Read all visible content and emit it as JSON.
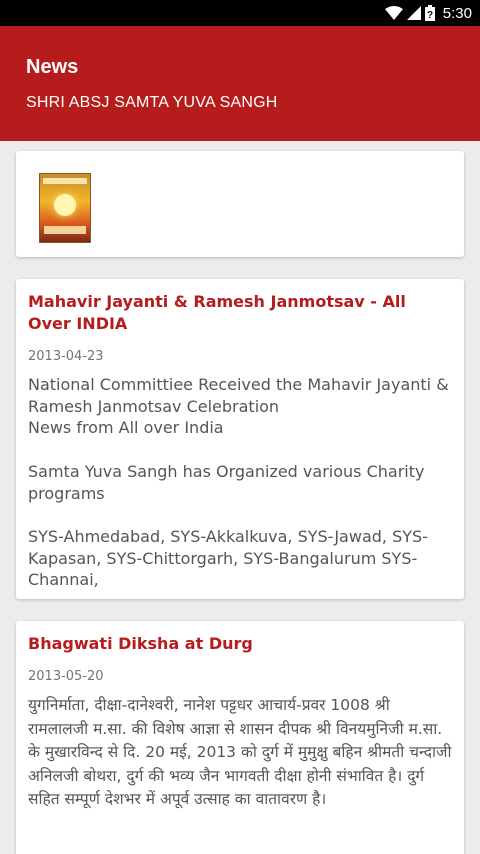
{
  "status_bar": {
    "time": "5:30",
    "icons": [
      "wifi-icon",
      "signal-icon",
      "battery-icon"
    ]
  },
  "app_bar": {
    "title": "News",
    "subtitle": "SHRI ABSJ SAMTA YUVA SANGH",
    "color": "#b71c1c"
  },
  "news": [
    {
      "title": "Mahavir Jayanti & Ramesh Janmotsav - All Over INDIA",
      "date": "2013-04-23",
      "body": "National Committiee Received the Mahavir Jayanti & Ramesh Janmotsav Celebration\nNews from All over India\n\nSamta Yuva Sangh has Organized various Charity programs\n\nSYS-Ahmedabad, SYS-Akkalkuva, SYS-Jawad, SYS-Kapasan, SYS-Chittorgarh, SYS-Bangalurum SYS-Channai,"
    },
    {
      "title": "Bhagwati Diksha at Durg",
      "date": "2013-05-20",
      "body": "युगनिर्माता, दीक्षा-दानेश्वरी, नानेश पट्टधर आचार्य-प्रवर 1008 श्री रामलालजी म.सा. की विशेष आज्ञा से शासन दीपक श्री विनयमुनिजी म.सा. के मुखारविन्द से दि. 20 मई, 2013 को दुर्ग में मुमुक्षु बहिन श्रीमती चन्दाजी अनिलजी बोथरा, दुर्ग की भव्य जैन भागवती दीक्षा होनी संभावित है। दुर्ग सहित सम्पूर्ण देशभर में अपूर्व उत्साह का वातावरण है।"
    }
  ]
}
